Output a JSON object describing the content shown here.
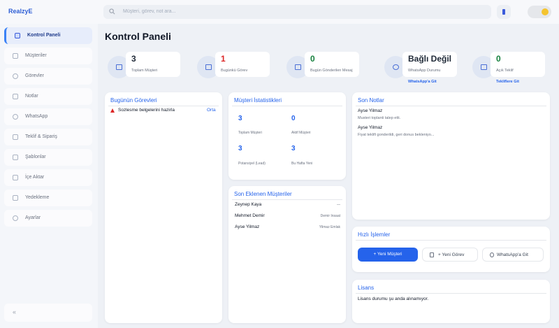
{
  "app": {
    "brand": "RealzyE"
  },
  "search": {
    "placeholder": "Müşteri, görev, not ara..."
  },
  "sidebar": {
    "items": [
      {
        "label": "Kontrol Paneli",
        "active": true
      },
      {
        "label": "Müşteriler"
      },
      {
        "label": "Görevler"
      },
      {
        "label": "Notlar"
      },
      {
        "label": "WhatsApp"
      },
      {
        "label": "Teklif & Sipariş"
      },
      {
        "label": "Şablonlar"
      },
      {
        "label": "İçe Aktar"
      },
      {
        "label": "Yedekleme"
      },
      {
        "label": "Ayarlar"
      }
    ],
    "collapse_label": "«"
  },
  "page": {
    "title": "Kontrol Paneli"
  },
  "stats": [
    {
      "value": "3",
      "label": "Toplam Müşteri",
      "color": "#111827"
    },
    {
      "value": "1",
      "label": "Bugünkü Görev",
      "color": "#dc2626"
    },
    {
      "value": "0",
      "label": "Bugün Gönderilen Mesaj",
      "color": "#15803d"
    },
    {
      "value": "Bağlı Değil",
      "label": "WhatsApp Durumu",
      "link": "WhatsApp'a Git",
      "color": "#111827"
    },
    {
      "value": "0",
      "label": "Açık Teklif",
      "link": "Tekliflere Git",
      "color": "#15803d"
    }
  ],
  "today_tasks": {
    "title": "Bugünün Görevleri",
    "items": [
      {
        "text": "Sozlesme belgelerini hazirla",
        "priority": "Orta"
      }
    ]
  },
  "customer_stats": {
    "title": "Müşteri İstatistikleri",
    "items": [
      {
        "value": "3",
        "label": "Toplam Müşteri"
      },
      {
        "value": "0",
        "label": "Aktif Müşteri"
      },
      {
        "value": "3",
        "label": "Potansiyel (Lead)"
      },
      {
        "value": "3",
        "label": "Bu Hafta Yeni"
      }
    ]
  },
  "recent_customers": {
    "title": "Son Eklenen Müşteriler",
    "items": [
      {
        "name": "Zeynep Kaya",
        "company": "—"
      },
      {
        "name": "Mehmet Demir",
        "company": "Demir Insaat"
      },
      {
        "name": "Ayse Yilmaz",
        "company": "Yilmaz Emlak"
      }
    ]
  },
  "recent_notes": {
    "title": "Son Notlar",
    "items": [
      {
        "name": "Ayse Yilmaz",
        "text": "Musteri toplanti talep etti."
      },
      {
        "name": "Ayse Yilmaz",
        "text": "Fiyat teklifi gonderildi, geri donus bekleniyo..."
      }
    ]
  },
  "quick_actions": {
    "title": "Hızlı İşlemler",
    "new_customer": "+ Yeni Müşteri",
    "new_task": "+ Yeni Görev",
    "whatsapp": "WhatsApp'a Git"
  },
  "license": {
    "title": "Lisans",
    "text": "Lisans durumu şu anda alınamıyor."
  }
}
